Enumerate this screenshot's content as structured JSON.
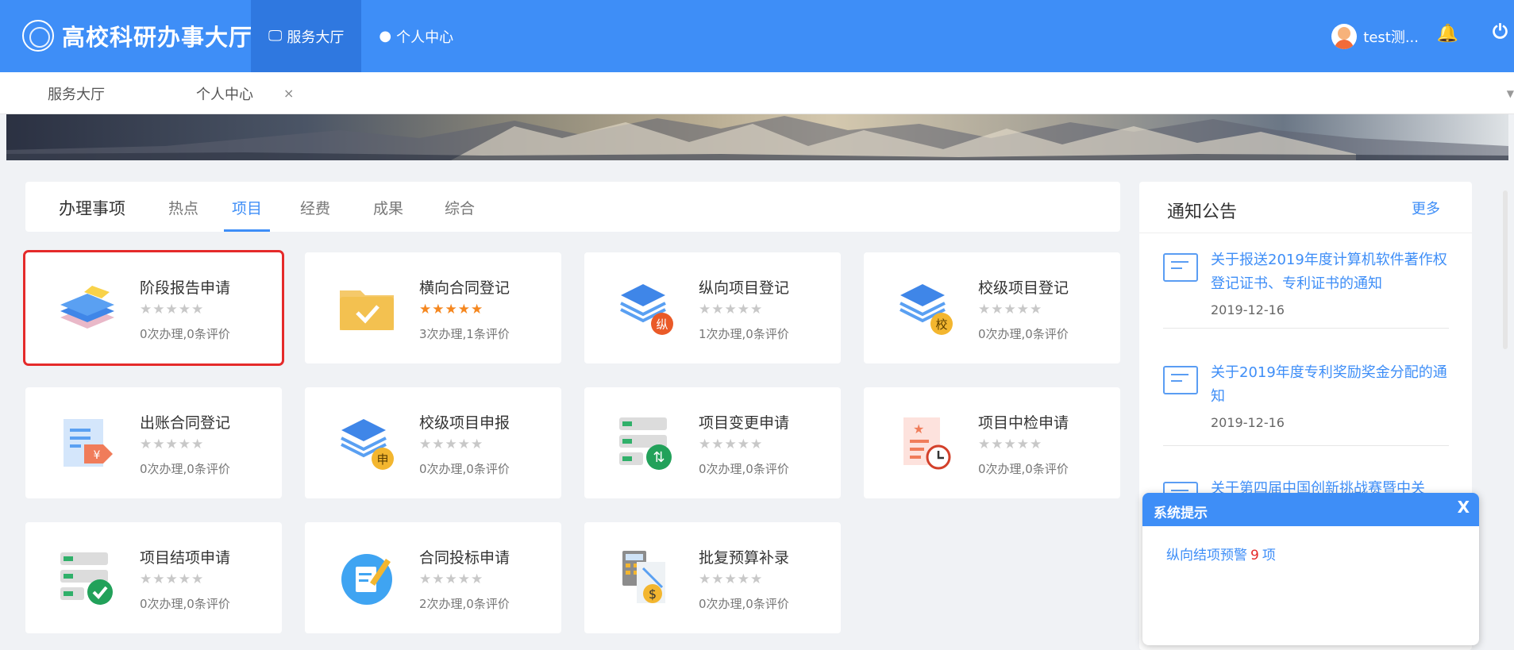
{
  "header": {
    "app_title": "高校科研办事大厅",
    "nav": [
      {
        "icon": "monitor-icon",
        "label": "服务大厅",
        "active": true
      },
      {
        "icon": "person-icon",
        "label": "个人中心",
        "active": false
      }
    ],
    "user_name": "test测...",
    "bell_icon": "bell-icon",
    "power_icon": "power-icon"
  },
  "page_tabs": [
    {
      "label": "服务大厅"
    },
    {
      "label": "个人中心",
      "close": "×"
    }
  ],
  "main": {
    "section_label": "办理事项",
    "tabs": [
      "热点",
      "项目",
      "经费",
      "成果",
      "综合"
    ],
    "active_tab": "项目",
    "cards": [
      {
        "title": "阶段报告申请",
        "stars": "★★★★★",
        "rating": 0,
        "stats": "0次办理,0条评价",
        "icon": "books-icon",
        "selected": true
      },
      {
        "title": "横向合同登记",
        "stars": "★★★★★",
        "rating": 5,
        "stats": "3次办理,1条评价",
        "icon": "folder-check-icon"
      },
      {
        "title": "纵向项目登记",
        "stars": "★★★★★",
        "rating": 0,
        "stats": "1次办理,0条评价",
        "icon": "layers-badge-icon",
        "badge": "纵"
      },
      {
        "title": "校级项目登记",
        "stars": "★★★★★",
        "rating": 0,
        "stats": "0次办理,0条评价",
        "icon": "layers-badge-icon",
        "badge": "校"
      },
      {
        "title": "出账合同登记",
        "stars": "★★★★★",
        "rating": 0,
        "stats": "0次办理,0条评价",
        "icon": "document-yen-icon"
      },
      {
        "title": "校级项目申报",
        "stars": "★★★★★",
        "rating": 0,
        "stats": "0次办理,0条评价",
        "icon": "layers-badge-icon",
        "badge": "申"
      },
      {
        "title": "项目变更申请",
        "stars": "★★★★★",
        "rating": 0,
        "stats": "0次办理,0条评价",
        "icon": "server-sync-icon"
      },
      {
        "title": "项目中检申请",
        "stars": "★★★★★",
        "rating": 0,
        "stats": "0次办理,0条评价",
        "icon": "document-clock-icon"
      },
      {
        "title": "项目结项申请",
        "stars": "★★★★★",
        "rating": 0,
        "stats": "0次办理,0条评价",
        "icon": "server-check-icon"
      },
      {
        "title": "合同投标申请",
        "stars": "★★★★★",
        "rating": 0,
        "stats": "2次办理,0条评价",
        "icon": "edit-note-icon"
      },
      {
        "title": "批复预算补录",
        "stars": "★★★★★",
        "rating": 0,
        "stats": "0次办理,0条评价",
        "icon": "calculator-dollar-icon"
      }
    ]
  },
  "notice": {
    "title": "通知公告",
    "more": "更多",
    "items": [
      {
        "text": "关于报送2019年度计算机软件著作权登记证书、专利证书的通知",
        "date": "2019-12-16"
      },
      {
        "text": "关于2019年度专利奖励奖金分配的通知",
        "date": "2019-12-16"
      },
      {
        "text": "关于第四届中国创新挑战赛暨中关",
        "date": ""
      }
    ]
  },
  "popup": {
    "title": "系统提示",
    "close": "X",
    "message_prefix": "纵向结项预警",
    "count": "9",
    "message_suffix": "项"
  },
  "colors": {
    "brand": "#3e8ef7",
    "star_active": "#f5871f",
    "selected_border": "#e52a2a"
  }
}
